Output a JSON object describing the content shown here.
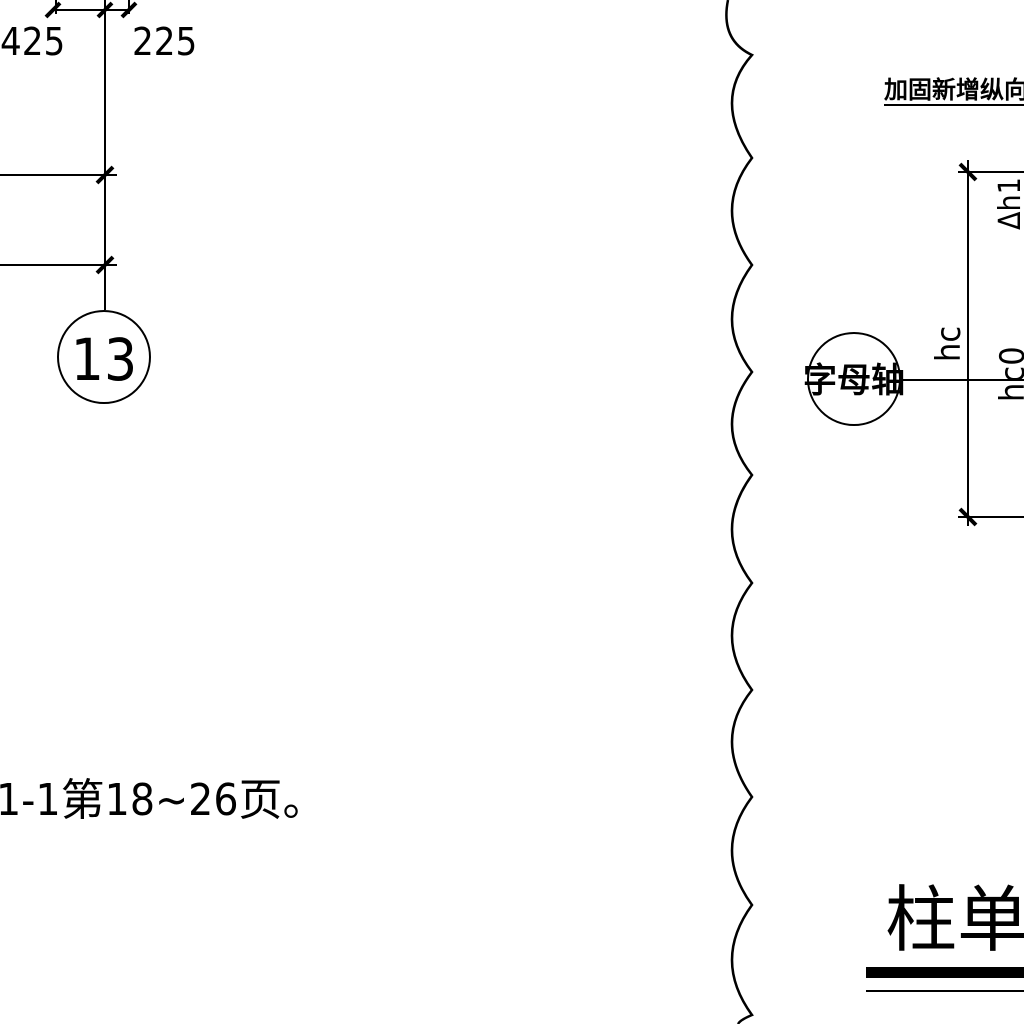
{
  "left_panel": {
    "dimensions": [
      "425",
      "225"
    ],
    "axis_bubble": "13",
    "reference_note": "1-1第18~26页。"
  },
  "right_panel": {
    "header_note": "加固新增纵向受力钢",
    "dimension_labels": {
      "delta_h": "Δh1",
      "hc": "hc",
      "hc0": "hc0"
    },
    "axis_bubble": "字母轴",
    "section_title": "柱单面"
  }
}
